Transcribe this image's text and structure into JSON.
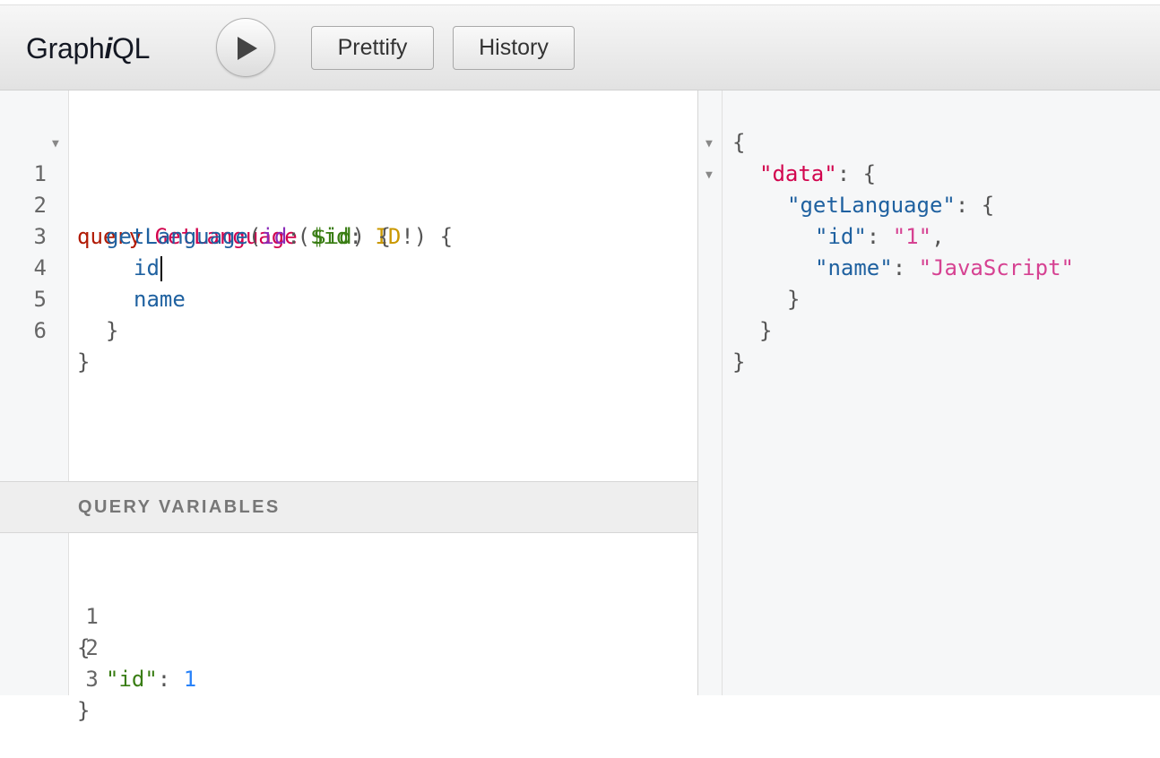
{
  "app": {
    "title_prefix": "Graph",
    "title_italic": "i",
    "title_suffix": "QL"
  },
  "toolbar": {
    "run_icon": "play-icon",
    "prettify_label": "Prettify",
    "history_label": "History"
  },
  "query_editor": {
    "line_numbers": [
      "1",
      "2",
      "3",
      "4",
      "5",
      "6"
    ],
    "lines": {
      "l1": {
        "kw": "query",
        "name": "GetLanguage",
        "open": "(",
        "var": "$id",
        "colon": ": ",
        "type": "ID",
        "bang": "!",
        "close": ") {"
      },
      "l2": {
        "field": "getLanguage",
        "open": "(",
        "arg": "id",
        "colon": ": ",
        "var": "$id",
        "close": ") {"
      },
      "l3": {
        "field": "id"
      },
      "l4": {
        "field": "name"
      },
      "l5": {
        "close": "}"
      },
      "l6": {
        "close": "}"
      }
    }
  },
  "variables": {
    "title": "QUERY VARIABLES",
    "line_numbers": [
      "1",
      "2",
      "3"
    ],
    "lines": {
      "l1": "{",
      "l2": {
        "key": "\"id\"",
        "colon": ": ",
        "value": "1"
      },
      "l3": "}"
    }
  },
  "result": {
    "l1": "{",
    "l2": {
      "key": "\"data\"",
      "rest": ": {"
    },
    "l3": {
      "key": "\"getLanguage\"",
      "rest": ": {"
    },
    "l4": {
      "key": "\"id\"",
      "colon": ": ",
      "value": "\"1\"",
      "comma": ","
    },
    "l5": {
      "key": "\"name\"",
      "colon": ": ",
      "value": "\"JavaScript\""
    },
    "l6": "}",
    "l7": "}",
    "l8": "}"
  },
  "colors": {
    "keyword": "#b11a04",
    "definition": "#d2054e",
    "variable": "#397d13",
    "type": "#ca9800",
    "property": "#1f61a0",
    "argument": "#8b2bb9",
    "number": "#2882f9",
    "string": "#d64292"
  }
}
